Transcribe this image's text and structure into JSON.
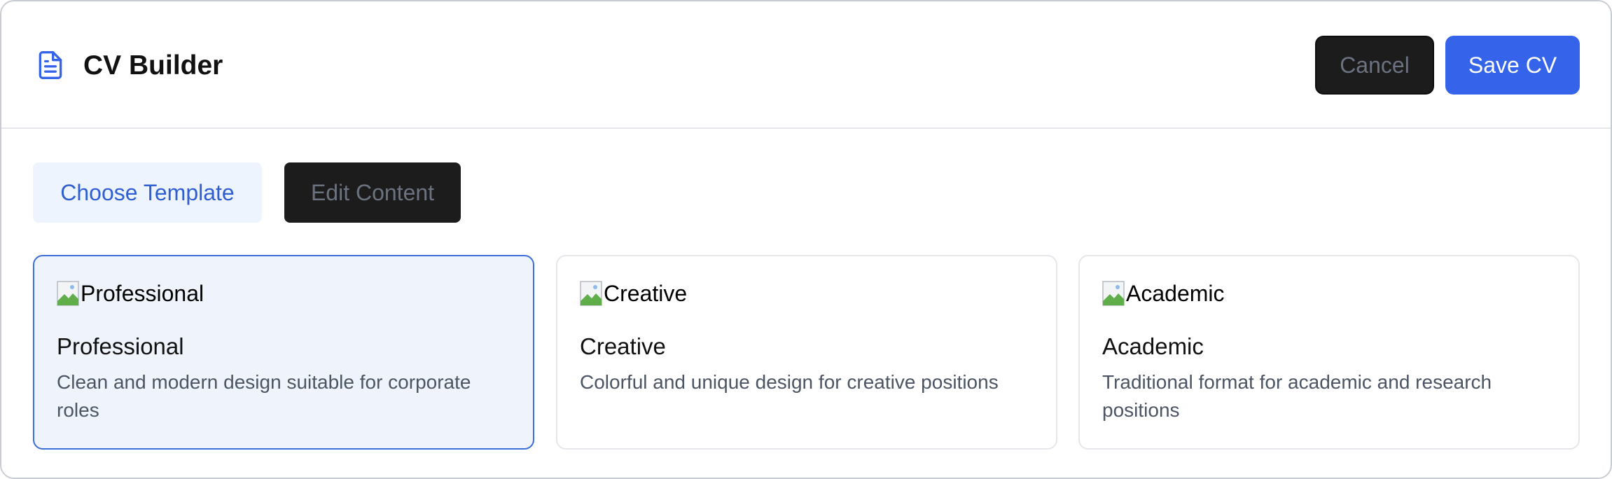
{
  "app": {
    "title": "CV Builder",
    "icon": "document-icon"
  },
  "header": {
    "cancel_label": "Cancel",
    "save_label": "Save CV"
  },
  "tabs": [
    {
      "label": "Choose Template",
      "active": true
    },
    {
      "label": "Edit Content",
      "active": false
    }
  ],
  "templates": [
    {
      "image_alt": "Professional",
      "title": "Professional",
      "description": "Clean and modern design suitable for corporate roles",
      "selected": true
    },
    {
      "image_alt": "Creative",
      "title": "Creative",
      "description": "Colorful and unique design for creative positions",
      "selected": false
    },
    {
      "image_alt": "Academic",
      "title": "Academic",
      "description": "Traditional format for academic and research positions",
      "selected": false
    }
  ],
  "colors": {
    "accent": "#3563e9",
    "selected_card_bg": "#eff4fc",
    "dark_button": "#1c1c1c"
  }
}
